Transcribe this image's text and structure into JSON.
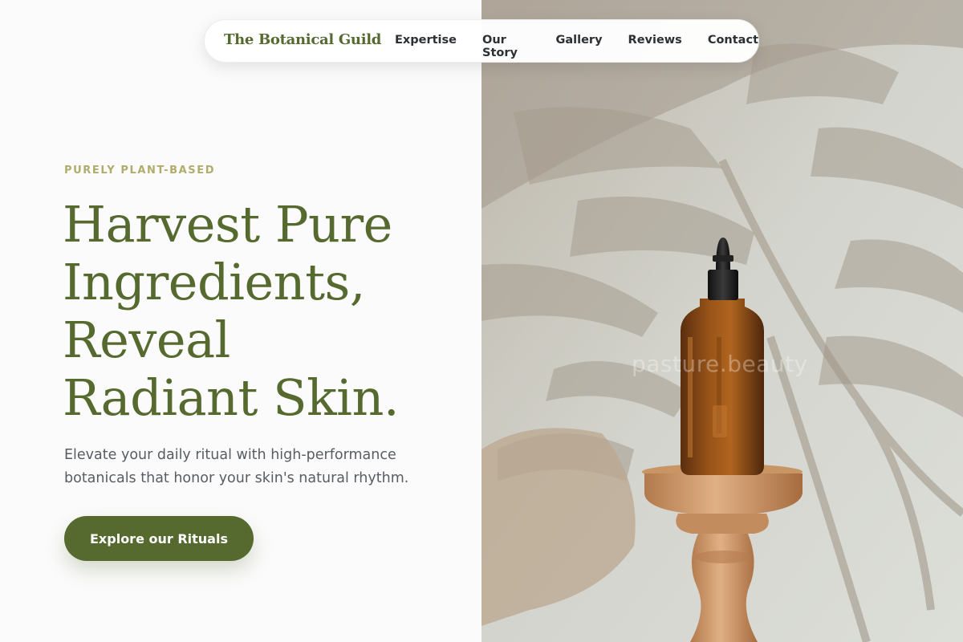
{
  "nav": {
    "brand": "The Botanical Guild",
    "links": [
      "Expertise",
      "Our Story",
      "Gallery",
      "Reviews",
      "Contact"
    ]
  },
  "hero": {
    "eyebrow": "PURELY PLANT-BASED",
    "headline_lines": [
      "Harvest Pure",
      "Ingredients,",
      "Reveal",
      "Radiant Skin."
    ],
    "subtitle": "Elevate your daily ritual with high-performance botanicals that honor your skin's natural rhythm.",
    "cta_label": "Explore our Rituals"
  },
  "image": {
    "watermark": "pasture.beauty"
  },
  "colors": {
    "accent": "#566a2f",
    "eyebrow": "#b0ad6c",
    "text_muted": "#585d63"
  }
}
